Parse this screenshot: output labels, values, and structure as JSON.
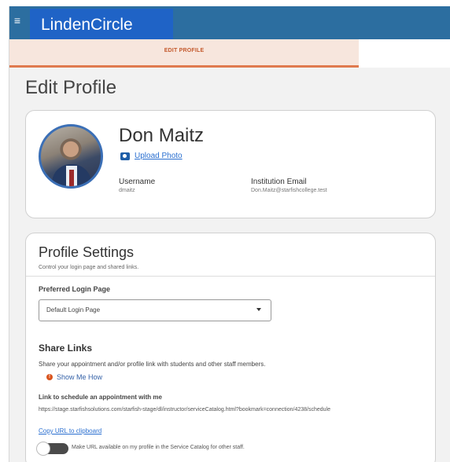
{
  "header": {
    "menu_glyph": "≡",
    "brand": "LindenCircle"
  },
  "tabs": [
    {
      "label": "EDIT PROFILE",
      "active": true
    }
  ],
  "page": {
    "title": "Edit Profile"
  },
  "profile": {
    "name": "Don Maitz",
    "upload_label": "Upload Photo",
    "username_label": "Username",
    "username_value": "dmaitz",
    "email_label": "Institution Email",
    "email_value": "Don.Maitz@starfishcollege.test"
  },
  "settings": {
    "title": "Profile Settings",
    "subtitle": "Control your login page and shared links.",
    "preferred_login_label": "Preferred Login Page",
    "preferred_login_value": "Default Login Page",
    "share_title": "Share Links",
    "share_description": "Share your appointment and/or profile link with students and other staff members.",
    "show_me_how": "Show Me How",
    "schedule_link_label": "Link to schedule an appointment with me",
    "schedule_link_url": "https://stage.starfishsolutions.com/starfish-stage/dl/instructor/serviceCatalog.html?bookmark=connection/4238/schedule",
    "copy_url_label": "Copy URL to clipboard",
    "make_url_available_label": "Make URL available on my profile in the Service Catalog for other staff.",
    "make_url_available": false
  },
  "colors": {
    "header": "#2c6ea0",
    "brand_block": "#1f63c6",
    "tab_active_bg": "#f7e6dd",
    "tab_active_accent": "#e07a4e",
    "link": "#2a6fd0"
  },
  "icons": {
    "menu": "hamburger-icon",
    "camera": "camera-icon",
    "info": "info-icon"
  }
}
